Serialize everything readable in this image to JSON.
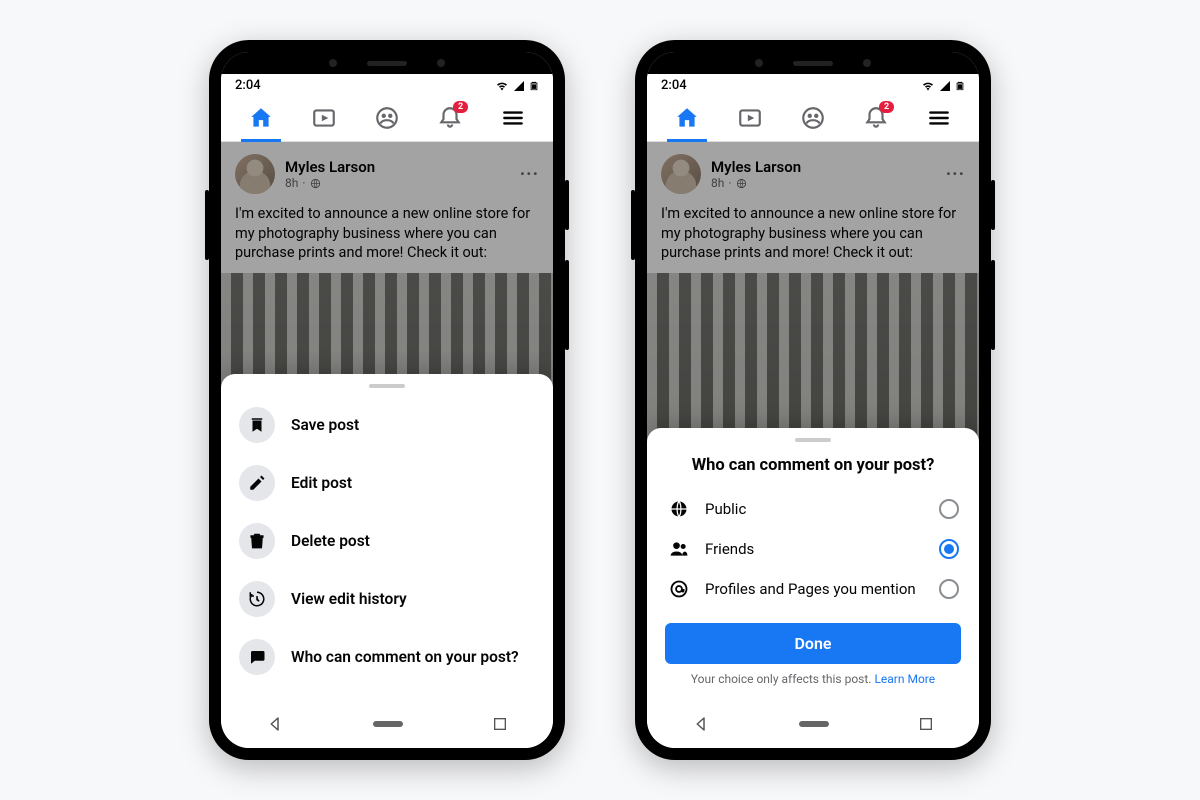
{
  "status": {
    "time": "2:04"
  },
  "nav": {
    "badge_count": "2"
  },
  "post": {
    "author": "Myles Larson",
    "meta_time": "8h",
    "text": "I'm excited to announce a new online store for my photography business where you can purchase prints and more! Check it out:"
  },
  "menu": {
    "save": "Save post",
    "edit": "Edit post",
    "delete": "Delete post",
    "history": "View edit history",
    "who_comment": "Who can comment on your post?"
  },
  "comment_sheet": {
    "title": "Who can comment on your post?",
    "option_public": "Public",
    "option_friends": "Friends",
    "option_mentions": "Profiles and Pages you mention",
    "done": "Done",
    "helper_text": "Your choice only affects this post. ",
    "learn_more": "Learn More"
  }
}
